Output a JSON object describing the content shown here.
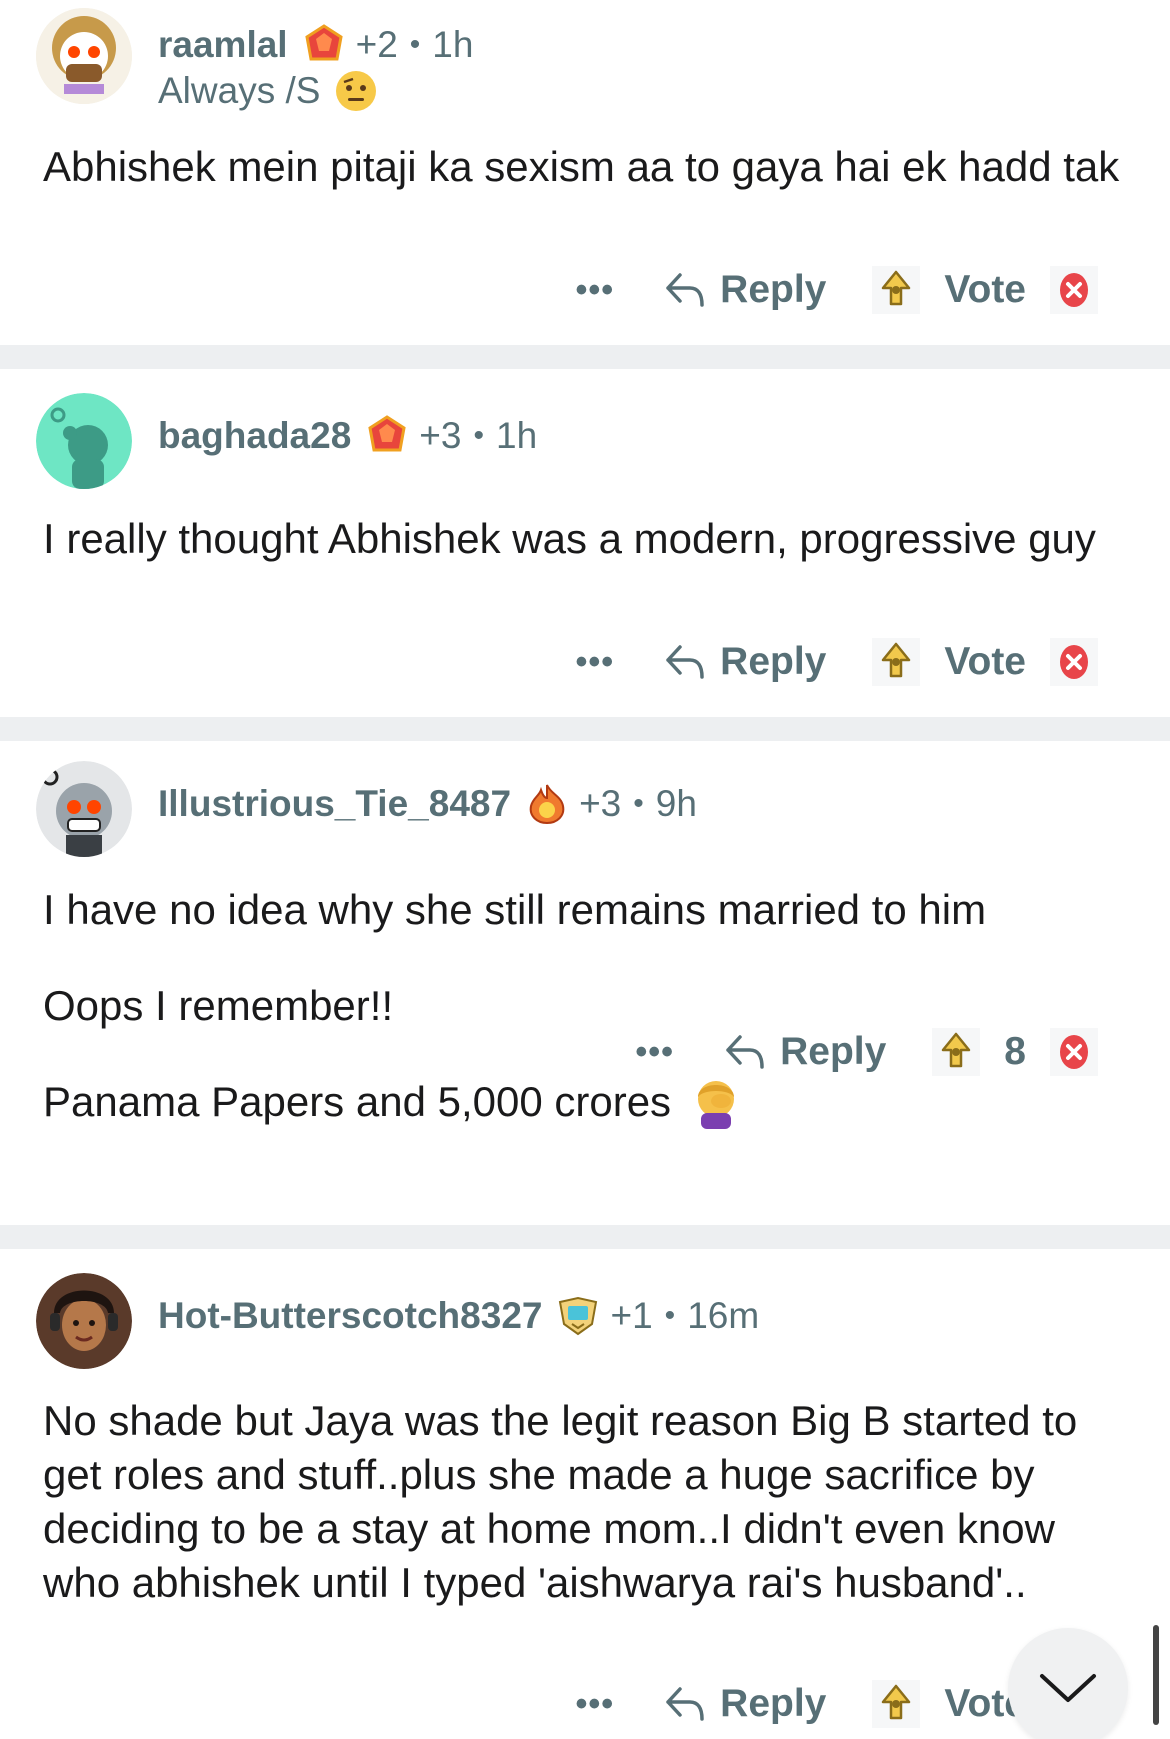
{
  "colors": {
    "meta_text": "#576f76",
    "body_text": "#1a1a1b",
    "separator": "#edeff1",
    "downvote": "#e8454a",
    "upvote_gold": "#f2c94c"
  },
  "comments": [
    {
      "username": "raamlal",
      "flair_icon": "ruby-award-icon",
      "karma": "+2",
      "age": "1h",
      "user_flair": "Always /S",
      "flair_emoji": "raised-eyebrow-emoji",
      "body": [
        "Abhishek mein pitaji ka sexism aa to gaya hai ek hadd tak"
      ],
      "more": "•••",
      "reply_label": "Reply",
      "vote_label": "Vote"
    },
    {
      "username": "baghada28",
      "flair_icon": "ruby-award-icon",
      "karma": "+3",
      "age": "1h",
      "body": [
        "I really thought Abhishek was a modern, progressive guy"
      ],
      "more": "•••",
      "reply_label": "Reply",
      "vote_label": "Vote"
    },
    {
      "username": "Illustrious_Tie_8487",
      "flair_icon": "fire-award-icon",
      "karma": "+3",
      "age": "9h",
      "body": [
        "I have no idea why she still remains married to him",
        "Oops I remember!!",
        "Panama Papers and 5,000 crores"
      ],
      "body_emoji": "facepalm-emoji",
      "more": "•••",
      "reply_label": "Reply",
      "vote_label": "8"
    },
    {
      "username": "Hot-Butterscotch8327",
      "flair_icon": "shield-award-icon",
      "karma": "+1",
      "age": "16m",
      "body": [
        "No shade but Jaya was the legit reason Big B started to get roles and stuff..plus she made a huge sacrifice by deciding to be a stay at home mom..I didn't even know who abhishek until I typed 'aishwarya rai's husband'.."
      ],
      "more": "•••",
      "reply_label": "Reply",
      "vote_label": "Vote"
    }
  ],
  "scroll_button_icon": "chevron-down-icon"
}
